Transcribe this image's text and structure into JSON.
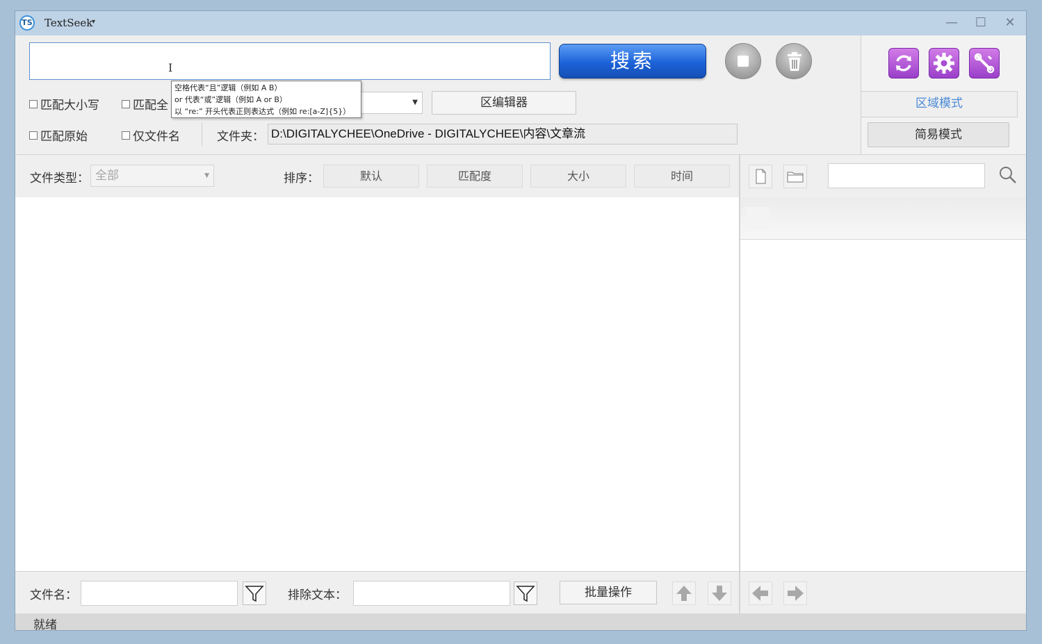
{
  "titlebar": {
    "logo_text": "TS",
    "app_name": "TextSeek",
    "caret": "▾",
    "minimize": "—",
    "maximize": "☐",
    "close": "✕"
  },
  "search": {
    "query": "",
    "button_label": "搜索",
    "tooltip_lines": [
      "空格代表“且”逻辑（例如 A  B）",
      "or 代表“或”逻辑（例如 A or B）",
      "以 “re:” 开头代表正则表达式（例如 re:[a-Z]{5}）"
    ]
  },
  "options": {
    "match_case": "匹配大小写",
    "match_whole_partial": "匹配全",
    "match_original": "匹配原始",
    "filename_only": "仅文件名",
    "region_editor": "区编辑器",
    "folder_label": "文件夹：",
    "folder_path": "D:\\DIGITALYCHEE\\OneDrive - DIGITALYCHEE\\内容\\文章流"
  },
  "modes": {
    "region_mode": "区域模式",
    "simple_mode": "简易模式"
  },
  "filter": {
    "file_type_label": "文件类型：",
    "file_type_value": "全部",
    "sort_label": "排序：",
    "sort_options": [
      "默认",
      "匹配度",
      "大小",
      "时间"
    ]
  },
  "bottom": {
    "filename_label": "文件名：",
    "exclude_label": "排除文本：",
    "batch_label": "批量操作"
  },
  "status": {
    "text": "就绪"
  },
  "colors": {
    "accent_blue": "#1c62d8",
    "purple": "#b15ad8",
    "mode_link": "#4b8ad6"
  }
}
